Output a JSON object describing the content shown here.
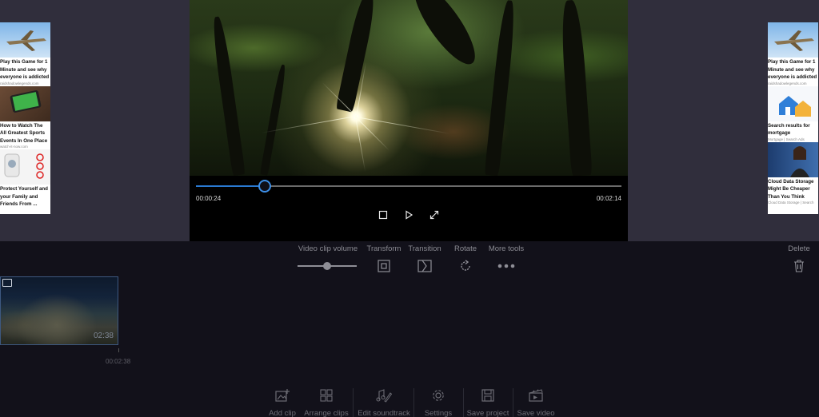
{
  "player": {
    "current_time": "00:00:24",
    "total_time": "00:02:14",
    "progress": 0.162,
    "buttons": [
      {
        "name": "stop-button",
        "icon": "stop-icon"
      },
      {
        "name": "play-button",
        "icon": "play-icon"
      },
      {
        "name": "fullscreen-button",
        "icon": "expand-icon"
      }
    ]
  },
  "tools": {
    "volume_label": "Video clip volume",
    "volume_level": 0.5,
    "transform_label": "Transform",
    "transition_label": "Transition",
    "rotate_label": "Rotate",
    "more_label": "More tools",
    "delete_label": "Delete"
  },
  "clip": {
    "duration": "02:38",
    "timeline_time": "00:02:38"
  },
  "bottom": {
    "add_clip": "Add clip",
    "arrange_clips": "Arrange clips",
    "edit_soundtrack": "Edit soundtrack",
    "settings": "Settings",
    "save_project": "Save project",
    "save_video": "Save video"
  },
  "ads": {
    "left": [
      {
        "text": "Play this Game for 1 Minute and see why everyone is addicted",
        "source": "raidshadowlegends.com"
      },
      {
        "text": "How to Watch The All Greatest Sports Events In One Place",
        "source": "watch-it-now.com"
      },
      {
        "text": "Protect Yourself and your Family and Friends From ...",
        "source": ""
      }
    ],
    "right": [
      {
        "text": "Play this Game for 1 Minute and see why everyone is addicted",
        "source": "raidshadowlegends.com"
      },
      {
        "text": "Search results for mortgage",
        "source": "Mortgage | Search Ads"
      },
      {
        "text": "Cloud Data Storage Might Be Cheaper Than You Think",
        "source": "Cloud Data Storage | Search"
      }
    ]
  },
  "colors": {
    "accent": "#3c8ee6",
    "top_band": "#302e3c",
    "background": "#12111a"
  }
}
